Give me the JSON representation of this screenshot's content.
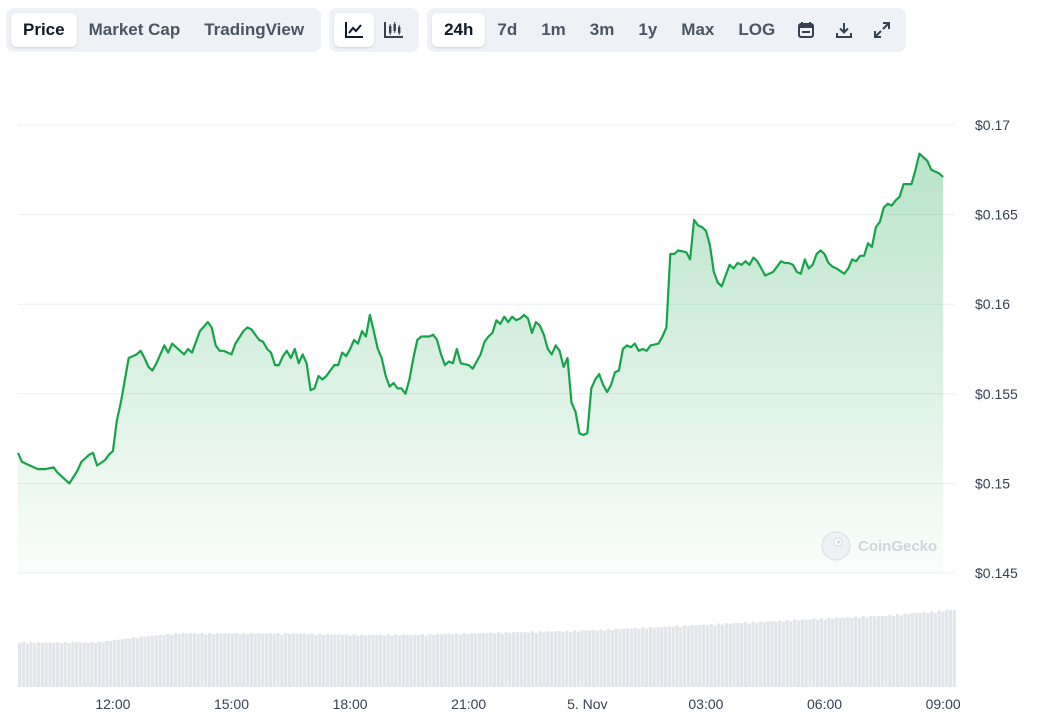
{
  "toolbar": {
    "metric_tabs": [
      {
        "label": "Price",
        "active": true
      },
      {
        "label": "Market Cap",
        "active": false
      },
      {
        "label": "TradingView",
        "active": false
      }
    ],
    "chart_type_icons": [
      "line-chart-icon",
      "candlestick-icon"
    ],
    "ranges": [
      {
        "label": "24h",
        "active": true
      },
      {
        "label": "7d",
        "active": false
      },
      {
        "label": "1m",
        "active": false
      },
      {
        "label": "3m",
        "active": false
      },
      {
        "label": "1y",
        "active": false
      },
      {
        "label": "Max",
        "active": false
      },
      {
        "label": "LOG",
        "active": false
      }
    ],
    "action_icons": [
      "calendar-icon",
      "download-icon",
      "expand-icon"
    ]
  },
  "watermark": "CoinGecko",
  "colors": {
    "line": "#16a34a",
    "fill_top": "#16a34a",
    "grid": "#eceff3",
    "volume": "#e2e5ea"
  },
  "chart_data": {
    "type": "area",
    "title": "",
    "xlabel": "",
    "ylabel": "",
    "y_ticks": [
      {
        "value": 0.17,
        "label": "$0.17"
      },
      {
        "value": 0.165,
        "label": "$0.165"
      },
      {
        "value": 0.16,
        "label": "$0.16"
      },
      {
        "value": 0.155,
        "label": "$0.155"
      },
      {
        "value": 0.15,
        "label": "$0.15"
      },
      {
        "value": 0.145,
        "label": "$0.145"
      }
    ],
    "ylim": [
      0.145,
      0.17
    ],
    "y_axis_side": "right",
    "grid": true,
    "x_range_hours": [
      9.6,
      33.3
    ],
    "x_ticks": [
      {
        "hour": 12,
        "label": "12:00"
      },
      {
        "hour": 15,
        "label": "15:00"
      },
      {
        "hour": 18,
        "label": "18:00"
      },
      {
        "hour": 21,
        "label": "21:00"
      },
      {
        "hour": 24,
        "label": "5. Nov"
      },
      {
        "hour": 27,
        "label": "03:00"
      },
      {
        "hour": 30,
        "label": "06:00"
      },
      {
        "hour": 33,
        "label": "09:00"
      }
    ],
    "series": [
      {
        "price": [
          [
            9.6,
            0.1517
          ],
          [
            9.7,
            0.1512
          ],
          [
            9.9,
            0.151
          ],
          [
            10.1,
            0.1508
          ],
          [
            10.3,
            0.1508
          ],
          [
            10.5,
            0.1509
          ],
          [
            10.6,
            0.1506
          ],
          [
            10.8,
            0.1502
          ],
          [
            10.9,
            0.15
          ],
          [
            11.1,
            0.1507
          ],
          [
            11.2,
            0.1512
          ],
          [
            11.4,
            0.1516
          ],
          [
            11.5,
            0.1517
          ],
          [
            11.6,
            0.151
          ],
          [
            11.8,
            0.1513
          ],
          [
            11.9,
            0.1516
          ],
          [
            12.0,
            0.1518
          ],
          [
            12.1,
            0.1535
          ],
          [
            12.2,
            0.1545
          ],
          [
            12.4,
            0.157
          ],
          [
            12.5,
            0.1571
          ],
          [
            12.6,
            0.1572
          ],
          [
            12.7,
            0.1574
          ],
          [
            12.8,
            0.157
          ],
          [
            12.9,
            0.1565
          ],
          [
            13.0,
            0.1563
          ],
          [
            13.1,
            0.1567
          ],
          [
            13.3,
            0.1577
          ],
          [
            13.4,
            0.1573
          ],
          [
            13.5,
            0.1578
          ],
          [
            13.6,
            0.1576
          ],
          [
            13.8,
            0.1572
          ],
          [
            13.9,
            0.1575
          ],
          [
            14.0,
            0.1573
          ],
          [
            14.2,
            0.1585
          ],
          [
            14.4,
            0.159
          ],
          [
            14.5,
            0.1587
          ],
          [
            14.6,
            0.1577
          ],
          [
            14.7,
            0.1574
          ],
          [
            14.8,
            0.1574
          ],
          [
            15.0,
            0.1572
          ],
          [
            15.1,
            0.1578
          ],
          [
            15.3,
            0.1585
          ],
          [
            15.4,
            0.1587
          ],
          [
            15.5,
            0.1586
          ],
          [
            15.7,
            0.158
          ],
          [
            15.8,
            0.1579
          ],
          [
            15.9,
            0.1575
          ],
          [
            16.0,
            0.1573
          ],
          [
            16.1,
            0.1566
          ],
          [
            16.2,
            0.1566
          ],
          [
            16.3,
            0.1571
          ],
          [
            16.4,
            0.1574
          ],
          [
            16.5,
            0.157
          ],
          [
            16.6,
            0.1575
          ],
          [
            16.7,
            0.1567
          ],
          [
            16.8,
            0.1572
          ],
          [
            16.9,
            0.1567
          ],
          [
            17.0,
            0.1552
          ],
          [
            17.1,
            0.1553
          ],
          [
            17.2,
            0.156
          ],
          [
            17.3,
            0.1558
          ],
          [
            17.4,
            0.156
          ],
          [
            17.5,
            0.1563
          ],
          [
            17.6,
            0.1566
          ],
          [
            17.7,
            0.1566
          ],
          [
            17.8,
            0.1573
          ],
          [
            17.9,
            0.1571
          ],
          [
            18.0,
            0.1575
          ],
          [
            18.1,
            0.158
          ],
          [
            18.2,
            0.1578
          ],
          [
            18.3,
            0.1585
          ],
          [
            18.4,
            0.1582
          ],
          [
            18.5,
            0.1594
          ],
          [
            18.6,
            0.1585
          ],
          [
            18.7,
            0.1575
          ],
          [
            18.8,
            0.157
          ],
          [
            18.9,
            0.156
          ],
          [
            19.0,
            0.1554
          ],
          [
            19.1,
            0.1556
          ],
          [
            19.2,
            0.1553
          ],
          [
            19.3,
            0.1553
          ],
          [
            19.4,
            0.155
          ],
          [
            19.5,
            0.1558
          ],
          [
            19.6,
            0.157
          ],
          [
            19.7,
            0.158
          ],
          [
            19.8,
            0.1582
          ],
          [
            20.0,
            0.1582
          ],
          [
            20.1,
            0.1583
          ],
          [
            20.2,
            0.158
          ],
          [
            20.3,
            0.1572
          ],
          [
            20.4,
            0.1566
          ],
          [
            20.5,
            0.1568
          ],
          [
            20.6,
            0.1567
          ],
          [
            20.7,
            0.1575
          ],
          [
            20.8,
            0.1567
          ],
          [
            21.0,
            0.1566
          ],
          [
            21.1,
            0.1564
          ],
          [
            21.3,
            0.1572
          ],
          [
            21.4,
            0.1579
          ],
          [
            21.5,
            0.1582
          ],
          [
            21.6,
            0.1584
          ],
          [
            21.7,
            0.1591
          ],
          [
            21.8,
            0.1589
          ],
          [
            21.9,
            0.1593
          ],
          [
            22.0,
            0.159
          ],
          [
            22.1,
            0.1593
          ],
          [
            22.2,
            0.1591
          ],
          [
            22.3,
            0.1592
          ],
          [
            22.4,
            0.1594
          ],
          [
            22.5,
            0.1592
          ],
          [
            22.6,
            0.1584
          ],
          [
            22.7,
            0.159
          ],
          [
            22.8,
            0.1588
          ],
          [
            22.9,
            0.1583
          ],
          [
            23.0,
            0.1575
          ],
          [
            23.1,
            0.1572
          ],
          [
            23.2,
            0.1577
          ],
          [
            23.3,
            0.1574
          ],
          [
            23.4,
            0.1565
          ],
          [
            23.5,
            0.157
          ],
          [
            23.6,
            0.1545
          ],
          [
            23.7,
            0.154
          ],
          [
            23.8,
            0.1528
          ],
          [
            23.9,
            0.1527
          ],
          [
            24.0,
            0.1528
          ],
          [
            24.1,
            0.1553
          ],
          [
            24.2,
            0.1558
          ],
          [
            24.3,
            0.1561
          ],
          [
            24.4,
            0.1555
          ],
          [
            24.5,
            0.1551
          ],
          [
            24.6,
            0.1555
          ],
          [
            24.7,
            0.1562
          ],
          [
            24.8,
            0.1563
          ],
          [
            24.9,
            0.1575
          ],
          [
            25.0,
            0.1577
          ],
          [
            25.1,
            0.1576
          ],
          [
            25.2,
            0.1578
          ],
          [
            25.3,
            0.1574
          ],
          [
            25.4,
            0.1575
          ],
          [
            25.5,
            0.1574
          ],
          [
            25.6,
            0.1577
          ],
          [
            25.8,
            0.1578
          ],
          [
            25.9,
            0.1582
          ],
          [
            26.0,
            0.1587
          ],
          [
            26.1,
            0.1628
          ],
          [
            26.2,
            0.1628
          ],
          [
            26.3,
            0.163
          ],
          [
            26.5,
            0.1629
          ],
          [
            26.6,
            0.1625
          ],
          [
            26.7,
            0.1647
          ],
          [
            26.8,
            0.1644
          ],
          [
            26.9,
            0.1643
          ],
          [
            27.0,
            0.1641
          ],
          [
            27.1,
            0.1633
          ],
          [
            27.2,
            0.1618
          ],
          [
            27.3,
            0.1612
          ],
          [
            27.4,
            0.161
          ],
          [
            27.6,
            0.1622
          ],
          [
            27.7,
            0.162
          ],
          [
            27.8,
            0.1623
          ],
          [
            27.9,
            0.1622
          ],
          [
            28.0,
            0.1624
          ],
          [
            28.1,
            0.1622
          ],
          [
            28.2,
            0.1626
          ],
          [
            28.3,
            0.1624
          ],
          [
            28.4,
            0.162
          ],
          [
            28.5,
            0.1616
          ],
          [
            28.6,
            0.1617
          ],
          [
            28.7,
            0.1618
          ],
          [
            28.8,
            0.1621
          ],
          [
            28.9,
            0.1624
          ],
          [
            29.0,
            0.1623
          ],
          [
            29.1,
            0.1623
          ],
          [
            29.2,
            0.1622
          ],
          [
            29.3,
            0.1618
          ],
          [
            29.4,
            0.1617
          ],
          [
            29.5,
            0.1625
          ],
          [
            29.6,
            0.162
          ],
          [
            29.7,
            0.1622
          ],
          [
            29.8,
            0.1628
          ],
          [
            29.9,
            0.163
          ],
          [
            30.0,
            0.1628
          ],
          [
            30.1,
            0.1623
          ],
          [
            30.2,
            0.1621
          ],
          [
            30.3,
            0.162
          ],
          [
            30.5,
            0.1617
          ],
          [
            30.6,
            0.162
          ],
          [
            30.7,
            0.1625
          ],
          [
            30.8,
            0.1624
          ],
          [
            30.9,
            0.1627
          ],
          [
            31.0,
            0.1627
          ],
          [
            31.1,
            0.1634
          ],
          [
            31.2,
            0.1632
          ],
          [
            31.3,
            0.1643
          ],
          [
            31.4,
            0.1646
          ],
          [
            31.5,
            0.1654
          ],
          [
            31.6,
            0.1656
          ],
          [
            31.7,
            0.1655
          ],
          [
            31.8,
            0.1658
          ],
          [
            31.9,
            0.166
          ],
          [
            32.0,
            0.1667
          ],
          [
            32.1,
            0.1667
          ],
          [
            32.2,
            0.1667
          ],
          [
            32.3,
            0.1675
          ],
          [
            32.4,
            0.1684
          ],
          [
            32.5,
            0.1682
          ],
          [
            32.6,
            0.168
          ],
          [
            32.7,
            0.1675
          ],
          [
            32.8,
            0.1674
          ],
          [
            32.9,
            0.1673
          ],
          [
            33.0,
            0.1671
          ]
        ]
      }
    ],
    "volume_relative": [
      [
        9.6,
        0.3
      ],
      [
        11.6,
        0.3
      ],
      [
        12.4,
        0.33
      ],
      [
        13.6,
        0.36
      ],
      [
        15.0,
        0.36
      ],
      [
        16.5,
        0.36
      ],
      [
        18.0,
        0.35
      ],
      [
        19.5,
        0.35
      ],
      [
        21.0,
        0.36
      ],
      [
        22.5,
        0.37
      ],
      [
        24.0,
        0.38
      ],
      [
        25.5,
        0.4
      ],
      [
        27.0,
        0.42
      ],
      [
        28.5,
        0.44
      ],
      [
        30.0,
        0.46
      ],
      [
        31.5,
        0.48
      ],
      [
        33.3,
        0.52
      ]
    ]
  }
}
